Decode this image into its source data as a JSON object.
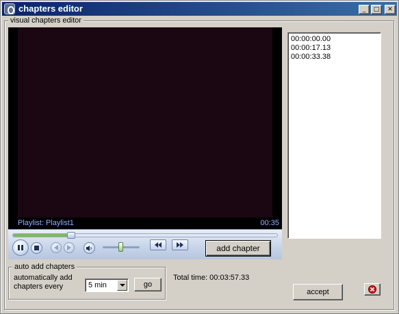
{
  "window": {
    "title": "chapters editor",
    "minimize_glyph": "_",
    "maximize_glyph": "□",
    "close_glyph": "✕"
  },
  "editor_group": {
    "legend": "visual chapters editor"
  },
  "player": {
    "playlist_label": "Playlist: Playlist1",
    "time": "00:35",
    "seek_progress": 0.22,
    "volume_level": 0.5
  },
  "buttons": {
    "add_chapter": "add chapter",
    "accept": "accept",
    "go": "go"
  },
  "chapters": [
    "00:00:00.00",
    "00:00:17.13",
    "00:00:33.38"
  ],
  "auto_group": {
    "legend": "auto add chapters",
    "label_line1": "automatically add",
    "label_line2": "chapters every",
    "interval": "5 min"
  },
  "total_time": "Total time: 00:03:57.33",
  "colors": {
    "title_bar": "#0a246a",
    "video_bg": "#1a0711",
    "close_icon": "#d01818"
  }
}
